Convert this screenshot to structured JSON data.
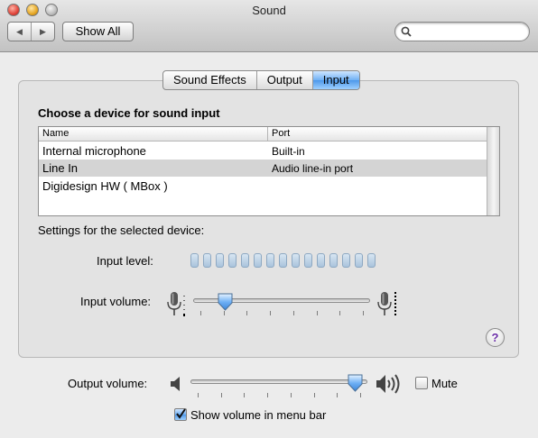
{
  "window": {
    "title": "Sound"
  },
  "toolbar": {
    "back_glyph": "◀",
    "forward_glyph": "▶",
    "show_all_label": "Show All",
    "search_value": "",
    "search_placeholder": ""
  },
  "tabs": [
    {
      "label": "Sound Effects",
      "selected": false
    },
    {
      "label": "Output",
      "selected": false
    },
    {
      "label": "Input",
      "selected": true
    }
  ],
  "input": {
    "choose_label": "Choose a device for sound input",
    "columns": [
      "Name",
      "Port"
    ],
    "devices": [
      {
        "name": "Internal microphone",
        "port": "Built-in",
        "selected": false
      },
      {
        "name": "Line In",
        "port": "Audio line-in port",
        "selected": true
      },
      {
        "name": "Digidesign HW ( MBox )",
        "port": "",
        "selected": false
      }
    ],
    "settings_label": "Settings for the selected device:",
    "input_level_label": "Input level:",
    "input_level_segments": 15,
    "input_level_active": 0,
    "input_volume_label": "Input volume:",
    "input_volume": 0.15
  },
  "help": {
    "glyph": "?"
  },
  "output": {
    "output_volume_label": "Output volume:",
    "output_volume": 0.97,
    "mute_label": "Mute",
    "mute_checked": false,
    "menubar_label": "Show volume in menu bar",
    "menubar_checked": true
  },
  "colors": {
    "accent": "#4d98ea",
    "help_glyph": "#6b2fa8",
    "level_segment": "#a9c3dc"
  }
}
